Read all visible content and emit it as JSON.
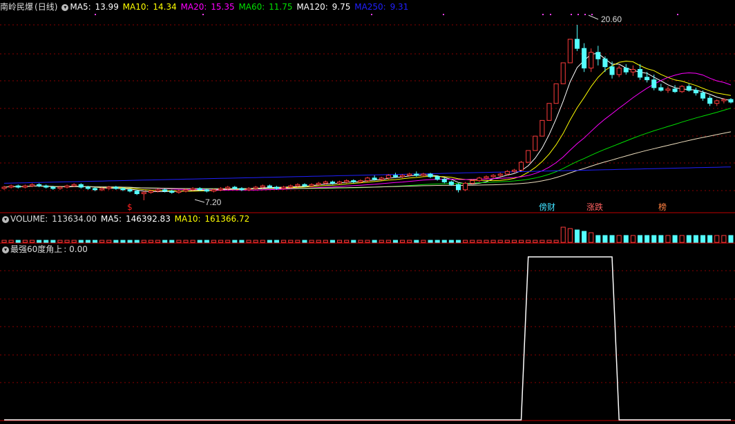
{
  "price_panel": {
    "stock_name": "南岭民爆",
    "period": "(日线)",
    "ma_readouts": [
      {
        "label": "MA5:",
        "value": "13.99",
        "color": "#ffffff"
      },
      {
        "label": "MA10:",
        "value": "14.34",
        "color": "#ffff00"
      },
      {
        "label": "MA20:",
        "value": "15.35",
        "color": "#ff00ff"
      },
      {
        "label": "MA60:",
        "value": "11.75",
        "color": "#00e000"
      },
      {
        "label": "MA120:",
        "value": "9.75",
        "color": "#ffffff"
      },
      {
        "label": "MA250:",
        "value": "9.31",
        "color": "#2020ff"
      }
    ],
    "high_label": "20.60",
    "low_label": "7.20",
    "signal_labels": [
      {
        "text": "$",
        "color": "#ff2020"
      },
      {
        "text": "傍财",
        "color": "#40e0ff"
      },
      {
        "text": "涨跌",
        "color": "#ff6060"
      },
      {
        "text": "榜",
        "color": "#ff8040"
      }
    ]
  },
  "volume_panel": {
    "label": "VOLUME:",
    "value": "113634.00",
    "ma_readouts": [
      {
        "label": "MA5:",
        "value": "146392.83",
        "color": "#ffffff"
      },
      {
        "label": "MA10:",
        "value": "161366.72",
        "color": "#ffff00"
      }
    ]
  },
  "indicator_panel": {
    "label": "最强60度角上",
    "value": ": 0.00"
  },
  "colors": {
    "up": "#ff3c3c",
    "down": "#54ffff",
    "grid": "#8b0000",
    "border": "#c00000"
  },
  "chart_data": {
    "type": "candlestick",
    "price_range": [
      7.2,
      20.6
    ],
    "candles": [
      [
        8.1,
        8.3,
        8.0,
        8.2
      ],
      [
        8.2,
        8.4,
        8.1,
        8.3
      ],
      [
        8.3,
        8.4,
        8.1,
        8.2
      ],
      [
        8.2,
        8.4,
        8.1,
        8.3
      ],
      [
        8.3,
        8.5,
        8.2,
        8.4
      ],
      [
        8.4,
        8.5,
        8.2,
        8.3
      ],
      [
        8.3,
        8.4,
        8.1,
        8.2
      ],
      [
        8.2,
        8.3,
        8.0,
        8.1
      ],
      [
        8.1,
        8.3,
        8.0,
        8.2
      ],
      [
        8.2,
        8.4,
        8.1,
        8.3
      ],
      [
        8.3,
        8.5,
        8.2,
        8.4
      ],
      [
        8.4,
        8.5,
        8.1,
        8.2
      ],
      [
        8.2,
        8.3,
        8.0,
        8.1
      ],
      [
        8.1,
        8.2,
        7.9,
        8.0
      ],
      [
        8.0,
        8.2,
        7.9,
        8.1
      ],
      [
        8.1,
        8.3,
        8.0,
        8.2
      ],
      [
        8.2,
        8.3,
        8.0,
        8.1
      ],
      [
        8.1,
        8.2,
        7.9,
        8.0
      ],
      [
        8.0,
        8.1,
        7.8,
        7.9
      ],
      [
        7.9,
        8.0,
        7.6,
        7.7
      ],
      [
        7.7,
        7.9,
        7.2,
        7.8
      ],
      [
        7.8,
        8.0,
        7.7,
        7.9
      ],
      [
        7.9,
        8.1,
        7.8,
        8.0
      ],
      [
        8.0,
        8.1,
        7.8,
        7.9
      ],
      [
        7.9,
        8.0,
        7.7,
        7.8
      ],
      [
        7.8,
        8.0,
        7.7,
        7.9
      ],
      [
        7.9,
        8.1,
        7.8,
        8.0
      ],
      [
        8.0,
        8.2,
        7.9,
        8.1
      ],
      [
        8.1,
        8.2,
        7.9,
        8.0
      ],
      [
        8.0,
        8.1,
        7.8,
        7.9
      ],
      [
        7.9,
        8.1,
        7.8,
        8.0
      ],
      [
        8.0,
        8.2,
        7.9,
        8.1
      ],
      [
        8.1,
        8.3,
        8.0,
        8.2
      ],
      [
        8.2,
        8.3,
        8.0,
        8.1
      ],
      [
        8.1,
        8.2,
        7.9,
        8.0
      ],
      [
        8.0,
        8.2,
        7.9,
        8.1
      ],
      [
        8.1,
        8.3,
        8.0,
        8.2
      ],
      [
        8.2,
        8.4,
        8.1,
        8.3
      ],
      [
        8.3,
        8.4,
        8.1,
        8.2
      ],
      [
        8.2,
        8.3,
        8.0,
        8.1
      ],
      [
        8.1,
        8.3,
        8.0,
        8.2
      ],
      [
        8.2,
        8.4,
        8.1,
        8.3
      ],
      [
        8.3,
        8.5,
        8.2,
        8.4
      ],
      [
        8.4,
        8.5,
        8.2,
        8.3
      ],
      [
        8.3,
        8.5,
        8.2,
        8.4
      ],
      [
        8.4,
        8.6,
        8.3,
        8.5
      ],
      [
        8.5,
        8.7,
        8.4,
        8.6
      ],
      [
        8.6,
        8.7,
        8.4,
        8.5
      ],
      [
        8.5,
        8.7,
        8.4,
        8.6
      ],
      [
        8.6,
        8.8,
        8.5,
        8.7
      ],
      [
        8.7,
        8.8,
        8.5,
        8.6
      ],
      [
        8.6,
        8.8,
        8.5,
        8.7
      ],
      [
        8.7,
        9.0,
        8.6,
        8.9
      ],
      [
        8.9,
        9.1,
        8.7,
        8.8
      ],
      [
        8.8,
        9.0,
        8.7,
        8.9
      ],
      [
        8.9,
        9.2,
        8.8,
        9.1
      ],
      [
        9.1,
        9.3,
        8.9,
        9.0
      ],
      [
        9.0,
        9.2,
        8.9,
        9.1
      ],
      [
        9.1,
        9.3,
        9.0,
        9.2
      ],
      [
        9.2,
        9.4,
        9.0,
        9.1
      ],
      [
        9.1,
        9.3,
        9.0,
        9.2
      ],
      [
        9.2,
        9.3,
        8.9,
        9.0
      ],
      [
        9.0,
        9.1,
        8.7,
        8.8
      ],
      [
        8.8,
        8.9,
        8.5,
        8.6
      ],
      [
        8.6,
        8.7,
        8.3,
        8.4
      ],
      [
        8.4,
        8.5,
        7.8,
        8.0
      ],
      [
        8.0,
        8.6,
        7.9,
        8.5
      ],
      [
        8.5,
        8.8,
        8.4,
        8.7
      ],
      [
        8.7,
        9.0,
        8.6,
        8.9
      ],
      [
        8.9,
        9.1,
        8.8,
        9.0
      ],
      [
        9.0,
        9.2,
        8.9,
        9.1
      ],
      [
        9.1,
        9.3,
        9.0,
        9.2
      ],
      [
        9.2,
        9.5,
        9.1,
        9.4
      ],
      [
        9.4,
        9.6,
        9.3,
        9.5
      ],
      [
        9.5,
        10.2,
        9.5,
        10.1
      ],
      [
        10.1,
        11.0,
        10.1,
        11.0
      ],
      [
        11.0,
        12.1,
        11.0,
        12.1
      ],
      [
        12.1,
        13.3,
        12.1,
        13.3
      ],
      [
        13.3,
        14.6,
        13.3,
        14.6
      ],
      [
        14.6,
        16.1,
        14.6,
        16.1
      ],
      [
        16.1,
        17.7,
        16.1,
        17.7
      ],
      [
        17.7,
        19.5,
        17.7,
        19.5
      ],
      [
        19.5,
        20.6,
        18.6,
        18.8
      ],
      [
        18.8,
        19.2,
        17.0,
        17.3
      ],
      [
        17.3,
        18.8,
        17.0,
        18.5
      ],
      [
        18.5,
        19.0,
        17.5,
        18.0
      ],
      [
        18.0,
        18.2,
        17.0,
        17.4
      ],
      [
        17.4,
        17.8,
        16.5,
        16.8
      ],
      [
        16.8,
        17.5,
        16.6,
        17.3
      ],
      [
        17.3,
        17.6,
        16.8,
        17.0
      ],
      [
        17.0,
        17.5,
        16.7,
        17.2
      ],
      [
        17.2,
        17.6,
        16.4,
        16.6
      ],
      [
        16.6,
        17.0,
        16.2,
        16.4
      ],
      [
        16.4,
        16.8,
        15.6,
        15.8
      ],
      [
        15.8,
        16.1,
        15.5,
        15.6
      ],
      [
        15.6,
        15.9,
        15.4,
        15.7
      ],
      [
        15.7,
        16.0,
        15.4,
        15.5
      ],
      [
        15.5,
        16.0,
        15.4,
        15.9
      ],
      [
        15.9,
        16.1,
        15.5,
        15.6
      ],
      [
        15.6,
        15.8,
        15.2,
        15.4
      ],
      [
        15.4,
        15.6,
        14.8,
        15.0
      ],
      [
        15.0,
        15.2,
        14.4,
        14.6
      ],
      [
        14.6,
        14.9,
        14.4,
        14.8
      ],
      [
        14.8,
        15.0,
        14.6,
        14.9
      ],
      [
        14.9,
        15.0,
        14.6,
        14.7
      ]
    ],
    "indicator_levels": [
      0,
      0,
      0,
      0,
      0,
      0,
      0,
      0,
      0,
      0,
      0,
      0,
      0,
      0,
      0,
      0,
      0,
      0,
      0,
      0,
      0,
      0,
      0,
      0,
      0,
      0,
      0,
      0,
      0,
      0,
      0,
      0,
      0,
      0,
      0,
      0,
      0,
      0,
      0,
      0,
      0,
      0,
      0,
      0,
      0,
      0,
      0,
      0,
      0,
      0,
      0,
      0,
      0,
      0,
      0,
      0,
      0,
      0,
      0,
      0,
      0,
      0,
      0,
      0,
      0,
      0,
      0,
      0,
      0,
      0,
      0,
      0,
      0,
      0,
      0,
      1,
      1,
      1,
      1,
      1,
      1,
      1,
      1,
      1,
      1,
      1,
      1,
      1,
      0,
      0,
      0,
      0,
      0,
      0,
      0,
      0,
      0,
      0,
      0,
      0,
      0,
      0,
      0,
      0,
      0
    ]
  }
}
